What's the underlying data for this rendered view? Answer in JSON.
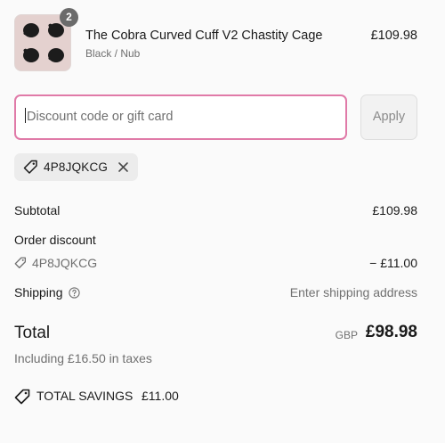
{
  "product": {
    "quantity": "2",
    "name": "The Cobra Curved Cuff V2 Chastity Cage",
    "variant": "Black / Nub",
    "price": "£109.98"
  },
  "discount": {
    "placeholder": "Discount code or gift card",
    "apply_label": "Apply",
    "applied_code": "4P8JQKCG"
  },
  "summary": {
    "subtotal_label": "Subtotal",
    "subtotal_value": "£109.98",
    "order_discount_label": "Order discount",
    "discount_code": "4P8JQKCG",
    "discount_value": "− £11.00",
    "shipping_label": "Shipping",
    "shipping_value": "Enter shipping address",
    "total_label": "Total",
    "total_currency": "GBP",
    "total_value": "£98.98",
    "taxes_note": "Including £16.50 in taxes",
    "savings_label": "TOTAL SAVINGS",
    "savings_value": "£11.00"
  },
  "colors": {
    "focus_border": "#e07aa8",
    "background": "#fafafa",
    "muted_text": "#707070"
  },
  "icons": [
    "tag-icon",
    "close-icon",
    "help-circle-icon",
    "savings-tag-icon"
  ]
}
